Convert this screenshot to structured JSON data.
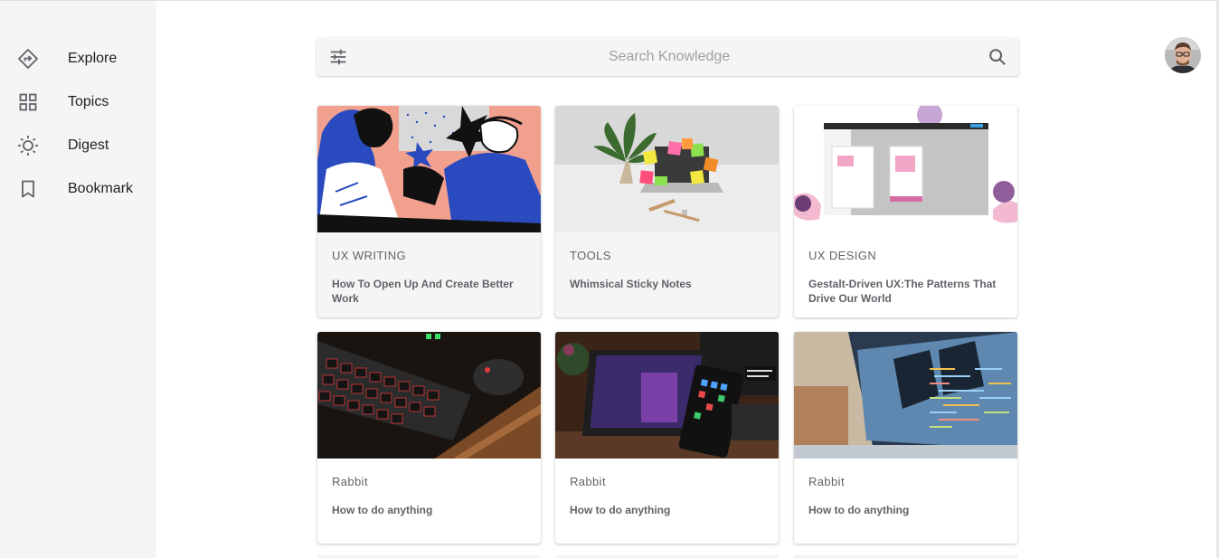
{
  "sidebar": {
    "items": [
      {
        "label": "Explore",
        "icon": "explore-icon"
      },
      {
        "label": "Topics",
        "icon": "grid-icon"
      },
      {
        "label": "Digest",
        "icon": "sun-icon"
      },
      {
        "label": "Bookmark",
        "icon": "bookmark-icon"
      }
    ]
  },
  "search": {
    "placeholder": "Search Knowledge",
    "value": ""
  },
  "cards": [
    {
      "category": "UX WRITING",
      "title": "How To Open Up And Create Better Work"
    },
    {
      "category": "TOOLS",
      "title": "Whimsical Sticky Notes"
    },
    {
      "category": "UX DESIGN",
      "title": "Gestalt-Driven UX:The Patterns That Drive Our World"
    },
    {
      "category": "Rabbit",
      "title": "How to do anything"
    },
    {
      "category": "Rabbit",
      "title": "How to do anything"
    },
    {
      "category": "Rabbit",
      "title": "How to do anything"
    }
  ],
  "colors": {
    "sidebar_bg": "#f5f5f6",
    "search_bg": "#f5f5f5",
    "muted_text": "#5f6368"
  }
}
